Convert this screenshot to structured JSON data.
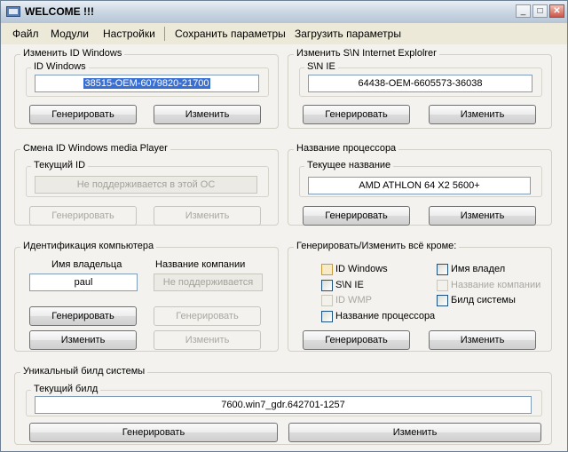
{
  "window": {
    "title": "WELCOME !!!"
  },
  "titlebar_buttons": {
    "minimize": "_",
    "maximize": "□",
    "close": "✕"
  },
  "menu": {
    "items": [
      "Файл",
      "Модули",
      "Настройки",
      "Сохранить параметры",
      "Загрузить параметры"
    ]
  },
  "windows_id": {
    "group_title": "Изменить ID Windows",
    "field_label": "ID Windows",
    "value": "38515-OEM-6079820-21700",
    "generate": "Генерировать",
    "change": "Изменить"
  },
  "ie_sn": {
    "group_title": "Изменить S\\N Internet Explolrer",
    "field_label": "S\\N IE",
    "value": "64438-OEM-6605573-36038",
    "generate": "Генерировать",
    "change": "Изменить"
  },
  "wmp_id": {
    "group_title": "Смена ID Windows media Player",
    "field_label": "Текущий ID",
    "value": "Не поддерживается в этой ОС",
    "generate": "Генерировать",
    "change": "Изменить"
  },
  "cpu": {
    "group_title": "Название процессора",
    "field_label": "Текущее название",
    "value": "AMD ATHLON 64 X2 5600+",
    "generate": "Генерировать",
    "change": "Изменить"
  },
  "computer": {
    "group_title": "Идентификация компьютера",
    "owner_label": "Имя владельца",
    "owner_value": "paul",
    "company_label": "Название компании",
    "company_value": "Не поддерживается",
    "generate": "Генерировать",
    "change": "Изменить",
    "company_generate": "Генерировать",
    "company_change": "Изменить"
  },
  "except": {
    "group_title": "Генерировать/Изменить всё кроме:",
    "opt_windows_id": "ID Windows",
    "opt_owner": "Имя владел",
    "opt_ie": "S\\N IE",
    "opt_company": "Название компании",
    "opt_wmp": "ID WMP",
    "opt_build": "Билд системы",
    "opt_cpu": "Название процессора",
    "generate": "Генерировать",
    "change": "Изменить"
  },
  "build": {
    "group_title": "Уникальный билд системы",
    "field_label": "Текущий билд",
    "value": "7600.win7_gdr.642701-1257",
    "generate": "Генерировать",
    "change": "Изменить"
  }
}
